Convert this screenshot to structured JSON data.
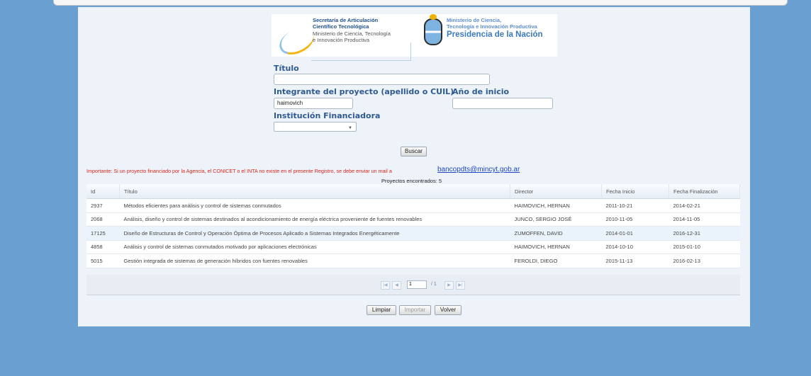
{
  "banner": {
    "sat_line1": "Secretaría de Articulación",
    "sat_line2": "Científico Tecnológica",
    "sat_line3": "Ministerio de Ciencia, Tecnología",
    "sat_line4": "e Innovación Productiva",
    "min_line1": "Ministerio de Ciencia,",
    "min_line2": "Tecnología e Innovación Productiva",
    "min_line3": "Presidencia de la Nación"
  },
  "form": {
    "titulo_label": "Título",
    "titulo_value": "",
    "integrante_label": "Integrante del proyecto (apellido o CUIL)",
    "integrante_value": "haimovich",
    "anio_label": "Año de inicio",
    "anio_value": "",
    "institucion_label": "Institución Financiadora",
    "institucion_value": "",
    "buscar": "Buscar"
  },
  "notice": {
    "important": "Importante: Si un proyecto financiado por la Agencia, el CONICET o el INTA no existe en el presente Registro, se debe enviar un mail a",
    "email": "bancopdts@mincyt.gob.ar",
    "found": "Proyectos encontrados: 5"
  },
  "table": {
    "headers": [
      "Id",
      "Título",
      "Director",
      "Fecha Inicio",
      "Fecha Finalización"
    ],
    "rows": [
      [
        "2937",
        "Métodos eficientes para análisis y control de sistemas conmutados",
        "HAIMOVICH, HERNAN",
        "2011-10-21",
        "2014-02-21"
      ],
      [
        "2068",
        "Análisis, diseño y control de sistemas destinados al acondicionamiento de energía eléctrica proveniente de fuentes renovables",
        "JUNCO, SERGIO JOSÉ",
        "2010-11-05",
        "2014-11-05"
      ],
      [
        "17125",
        "Diseño de Estructuras de Control y Operación Óptima de Procesos Aplicado a Sistemas Integrados Energéticamente",
        "ZUMOFFEN, DAVID",
        "2014-01-01",
        "2016-12-31"
      ],
      [
        "4858",
        "Análisis y control de sistemas conmutados motivado por aplicaciones electrónicas",
        "HAIMOVICH, HERNAN",
        "2014-10-10",
        "2015-01-10"
      ],
      [
        "5015",
        "Gestión integrada de sistemas de generación híbridos con fuentes renovables",
        "FEROLDI, DIEGO",
        "2015-11-13",
        "2016-02-13"
      ]
    ]
  },
  "pager": {
    "page": "1",
    "of": "/ 1"
  },
  "actions": {
    "limpiar": "Limpiar",
    "importar": "Importar",
    "volver": "Volver"
  }
}
